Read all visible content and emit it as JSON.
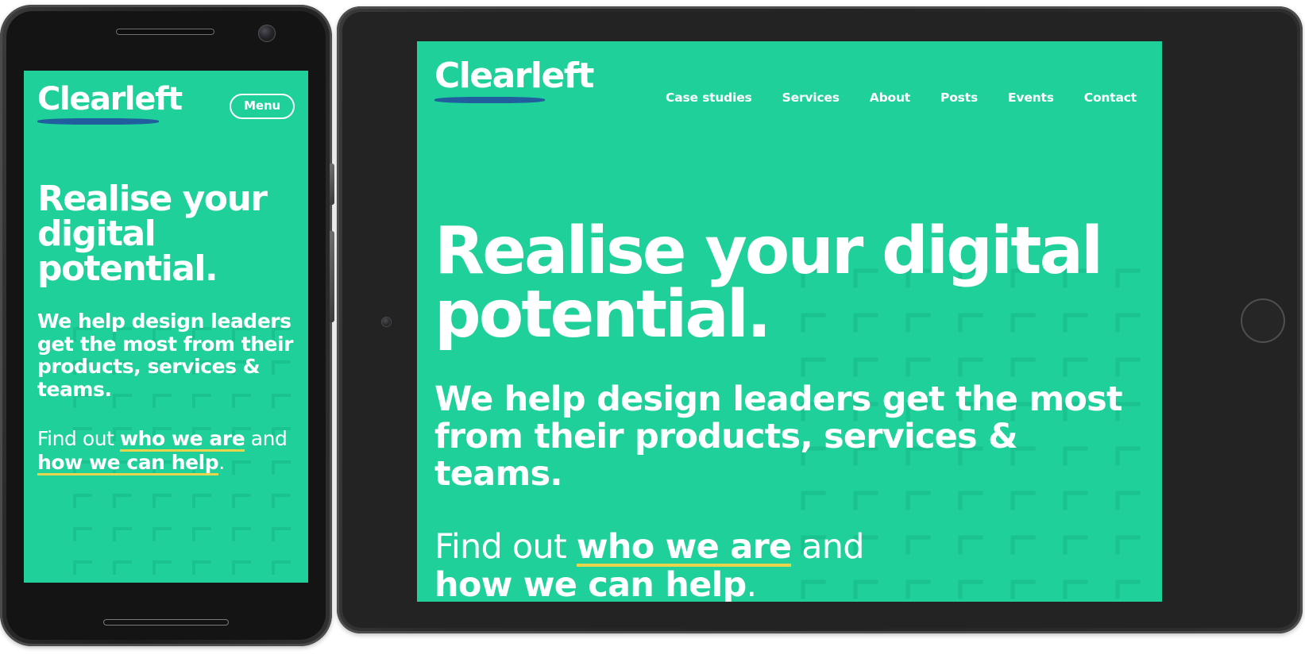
{
  "brand": {
    "name": "Clearleft",
    "bg_color": "#20D09A",
    "logo_underline_color": "#215E9E",
    "link_underline_color": "#E8D44D",
    "text_color": "#FFFFFF"
  },
  "phone": {
    "device": "smartphone",
    "menu_button_label": "Menu",
    "headline": "Realise your digital potential.",
    "lede": "We help design leaders get the most from their products, services & teams.",
    "findout": {
      "prefix": "Find out ",
      "link1": "who we are",
      "middle": " and ",
      "link2": "how we can help",
      "suffix": "."
    }
  },
  "tablet": {
    "device": "tablet",
    "nav_items": [
      {
        "label": "Case studies"
      },
      {
        "label": "Services"
      },
      {
        "label": "About"
      },
      {
        "label": "Posts"
      },
      {
        "label": "Events"
      },
      {
        "label": "Contact"
      }
    ],
    "headline": "Realise your digital potential.",
    "lede": "We help design leaders get the most from their products, services & teams.",
    "findout": {
      "prefix": "Find out ",
      "link1": "who we are",
      "middle": " and ",
      "link2": "how we can help",
      "suffix": "."
    }
  }
}
